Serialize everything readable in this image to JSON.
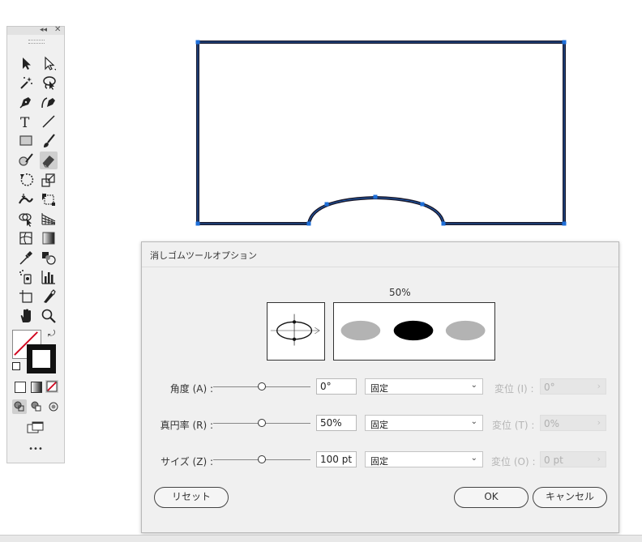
{
  "toolbar": {
    "collapse_icon": "double-chevron-left-icon",
    "close_icon": "close-icon",
    "type_tool_glyph": "T",
    "more_label": "•••"
  },
  "dialog": {
    "title": "消しゴムツールオプション",
    "preview_percent": "50%",
    "rows": [
      {
        "label": "角度 (A) :",
        "value": "0°",
        "mode": "固定",
        "variation_label": "変位 (I) :",
        "variation_value": "0°",
        "slider_position": 0.5
      },
      {
        "label": "真円率 (R) :",
        "value": "50%",
        "mode": "固定",
        "variation_label": "変位 (T) :",
        "variation_value": "0%",
        "slider_position": 0.5
      },
      {
        "label": "サイズ (Z) :",
        "value": "100 pt",
        "mode": "固定",
        "variation_label": "変位 (O) :",
        "variation_value": "0 pt",
        "slider_position": 0.5
      }
    ],
    "reset_label": "リセット",
    "ok_label": "OK",
    "cancel_label": "キャンセル"
  },
  "colors": {
    "selection": "#1e6fd9",
    "stroke": "#1a1a2e",
    "preview_gray": "#b3b3b3",
    "none_slash": "#d0021b"
  }
}
